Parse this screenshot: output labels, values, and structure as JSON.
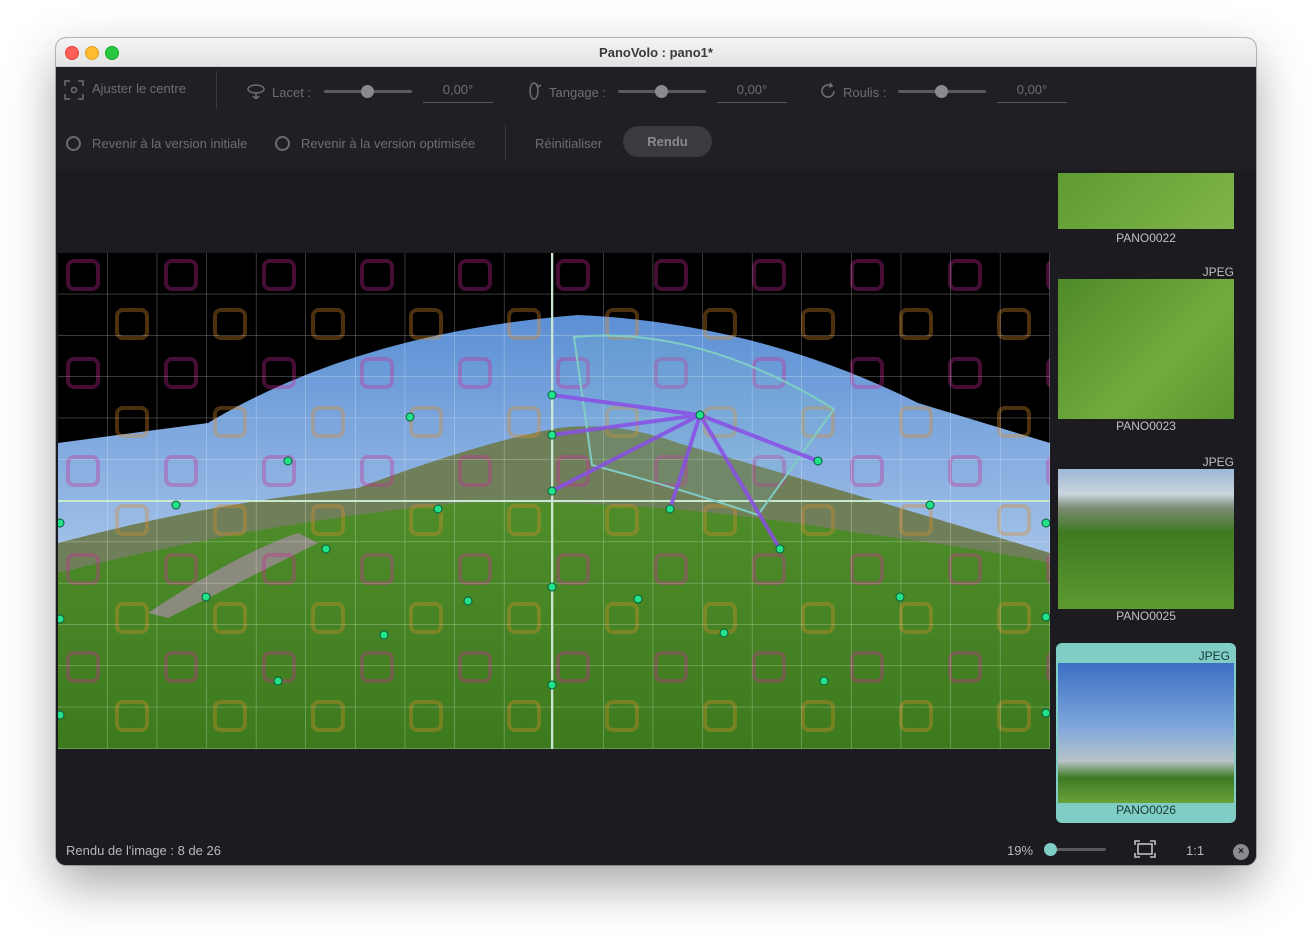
{
  "window": {
    "title": "PanoVolo : pano1*"
  },
  "toolbar": {
    "center_label": "Ajuster le centre",
    "yaw_label": "Lacet :",
    "yaw_value": "0,00°",
    "pitch_label": "Tangage :",
    "pitch_value": "0,00°",
    "roll_label": "Roulis :",
    "roll_value": "0,00°",
    "revert_initial": "Revenir à la version initiale",
    "revert_optimized": "Revenir à la version optimisée",
    "reset_label": "Réinitialiser",
    "render_label": "Rendu"
  },
  "sidebar": {
    "thumbnails": [
      {
        "format": "",
        "name": "PANO0022",
        "selected": false
      },
      {
        "format": "JPEG",
        "name": "PANO0023",
        "selected": false
      },
      {
        "format": "JPEG",
        "name": "PANO0025",
        "selected": false
      },
      {
        "format": "JPEG",
        "name": "PANO0026",
        "selected": true
      }
    ]
  },
  "status": {
    "progress_text": "Rendu de l'image : 8 de 26",
    "zoom": "19%",
    "zoom_fraction": 0.0,
    "actual_size_label": "1:1"
  },
  "colors": {
    "selection": "#7fcdc4",
    "control_point": "#22e28a",
    "link": "#8a4fe6"
  }
}
